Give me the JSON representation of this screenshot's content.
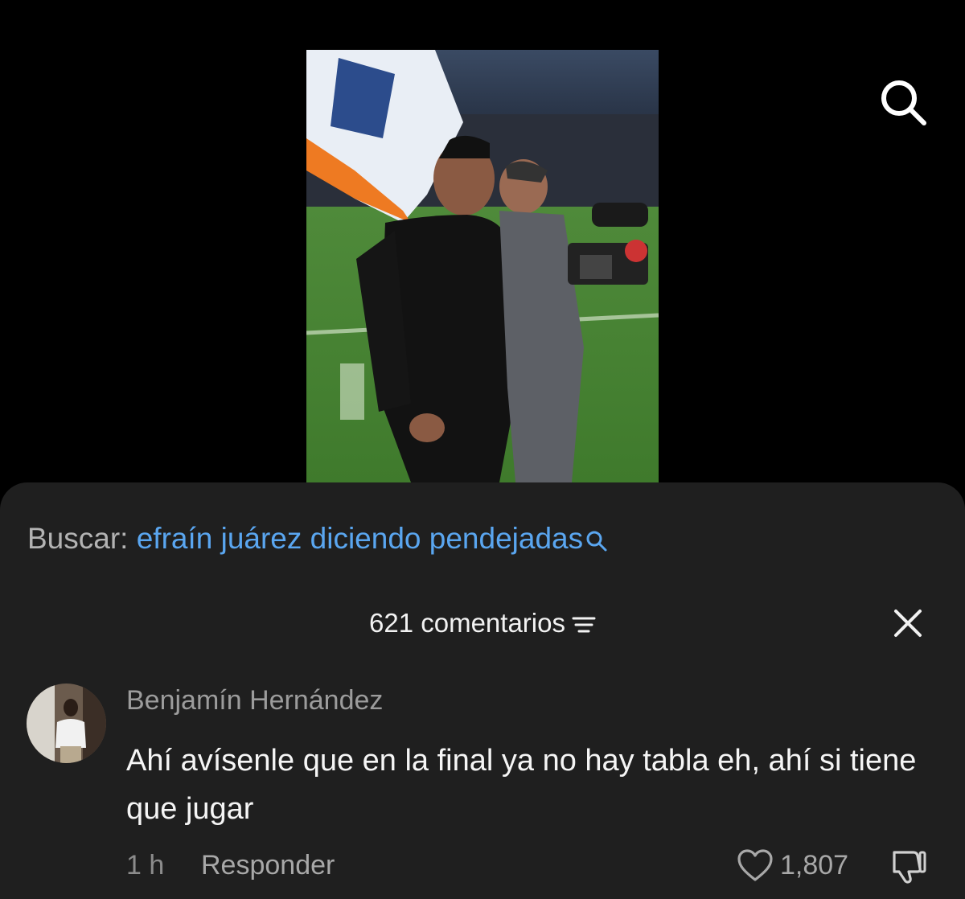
{
  "video": {
    "icon": "video-thumbnail"
  },
  "top_bar": {
    "search_icon": "search-icon"
  },
  "search_suggestion": {
    "prefix": "Buscar: ",
    "query": "efraín juárez diciendo pendejadas",
    "icon": "search-icon"
  },
  "comments_header": {
    "count_label": "621 comentarios",
    "sort_icon": "sort-icon",
    "close_icon": "close-icon"
  },
  "comment": {
    "author": "Benjamín Hernández",
    "text": "Ahí avísenle que en la final ya no hay tabla eh, ahí si tiene que jugar",
    "time": "1 h",
    "reply_label": "Responder",
    "likes": "1,807",
    "like_icon": "heart-icon",
    "dislike_icon": "dislike-icon"
  },
  "colors": {
    "background": "#000000",
    "sheet": "#1f1f1f",
    "link": "#5aa6f0",
    "muted": "#9c9c9c"
  }
}
